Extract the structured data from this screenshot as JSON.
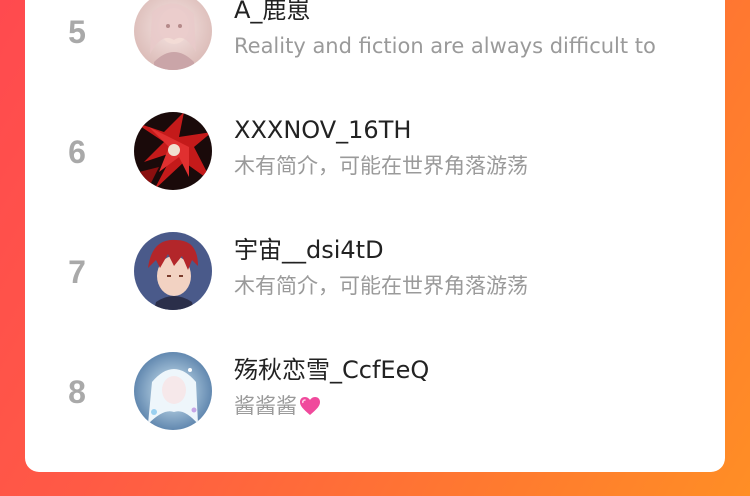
{
  "colors": {
    "rank_text": "#a9a9a9",
    "name_text": "#222222",
    "bio_text": "#9a9a9a",
    "card_bg": "#ffffff",
    "heart": "#f04a9c"
  },
  "ranking": {
    "items": [
      {
        "rank": "5",
        "name": "A_鹿崽",
        "bio": "Reality and fiction are always difficult to",
        "avatar_icon": "avatar-pale-girl-icon"
      },
      {
        "rank": "6",
        "name": "XXXNOV_16TH",
        "bio": "木有简介，可能在世界角落游荡",
        "avatar_icon": "avatar-red-black-icon"
      },
      {
        "rank": "7",
        "name": "宇宙__dsi4tD",
        "bio": "木有简介，可能在世界角落游荡",
        "avatar_icon": "avatar-red-hair-boy-icon"
      },
      {
        "rank": "8",
        "name": "殇秋恋雪_CcfEeQ",
        "bio": "酱酱酱",
        "bio_emoji": "pink-heart-icon",
        "avatar_icon": "avatar-white-hair-girl-icon"
      }
    ]
  }
}
